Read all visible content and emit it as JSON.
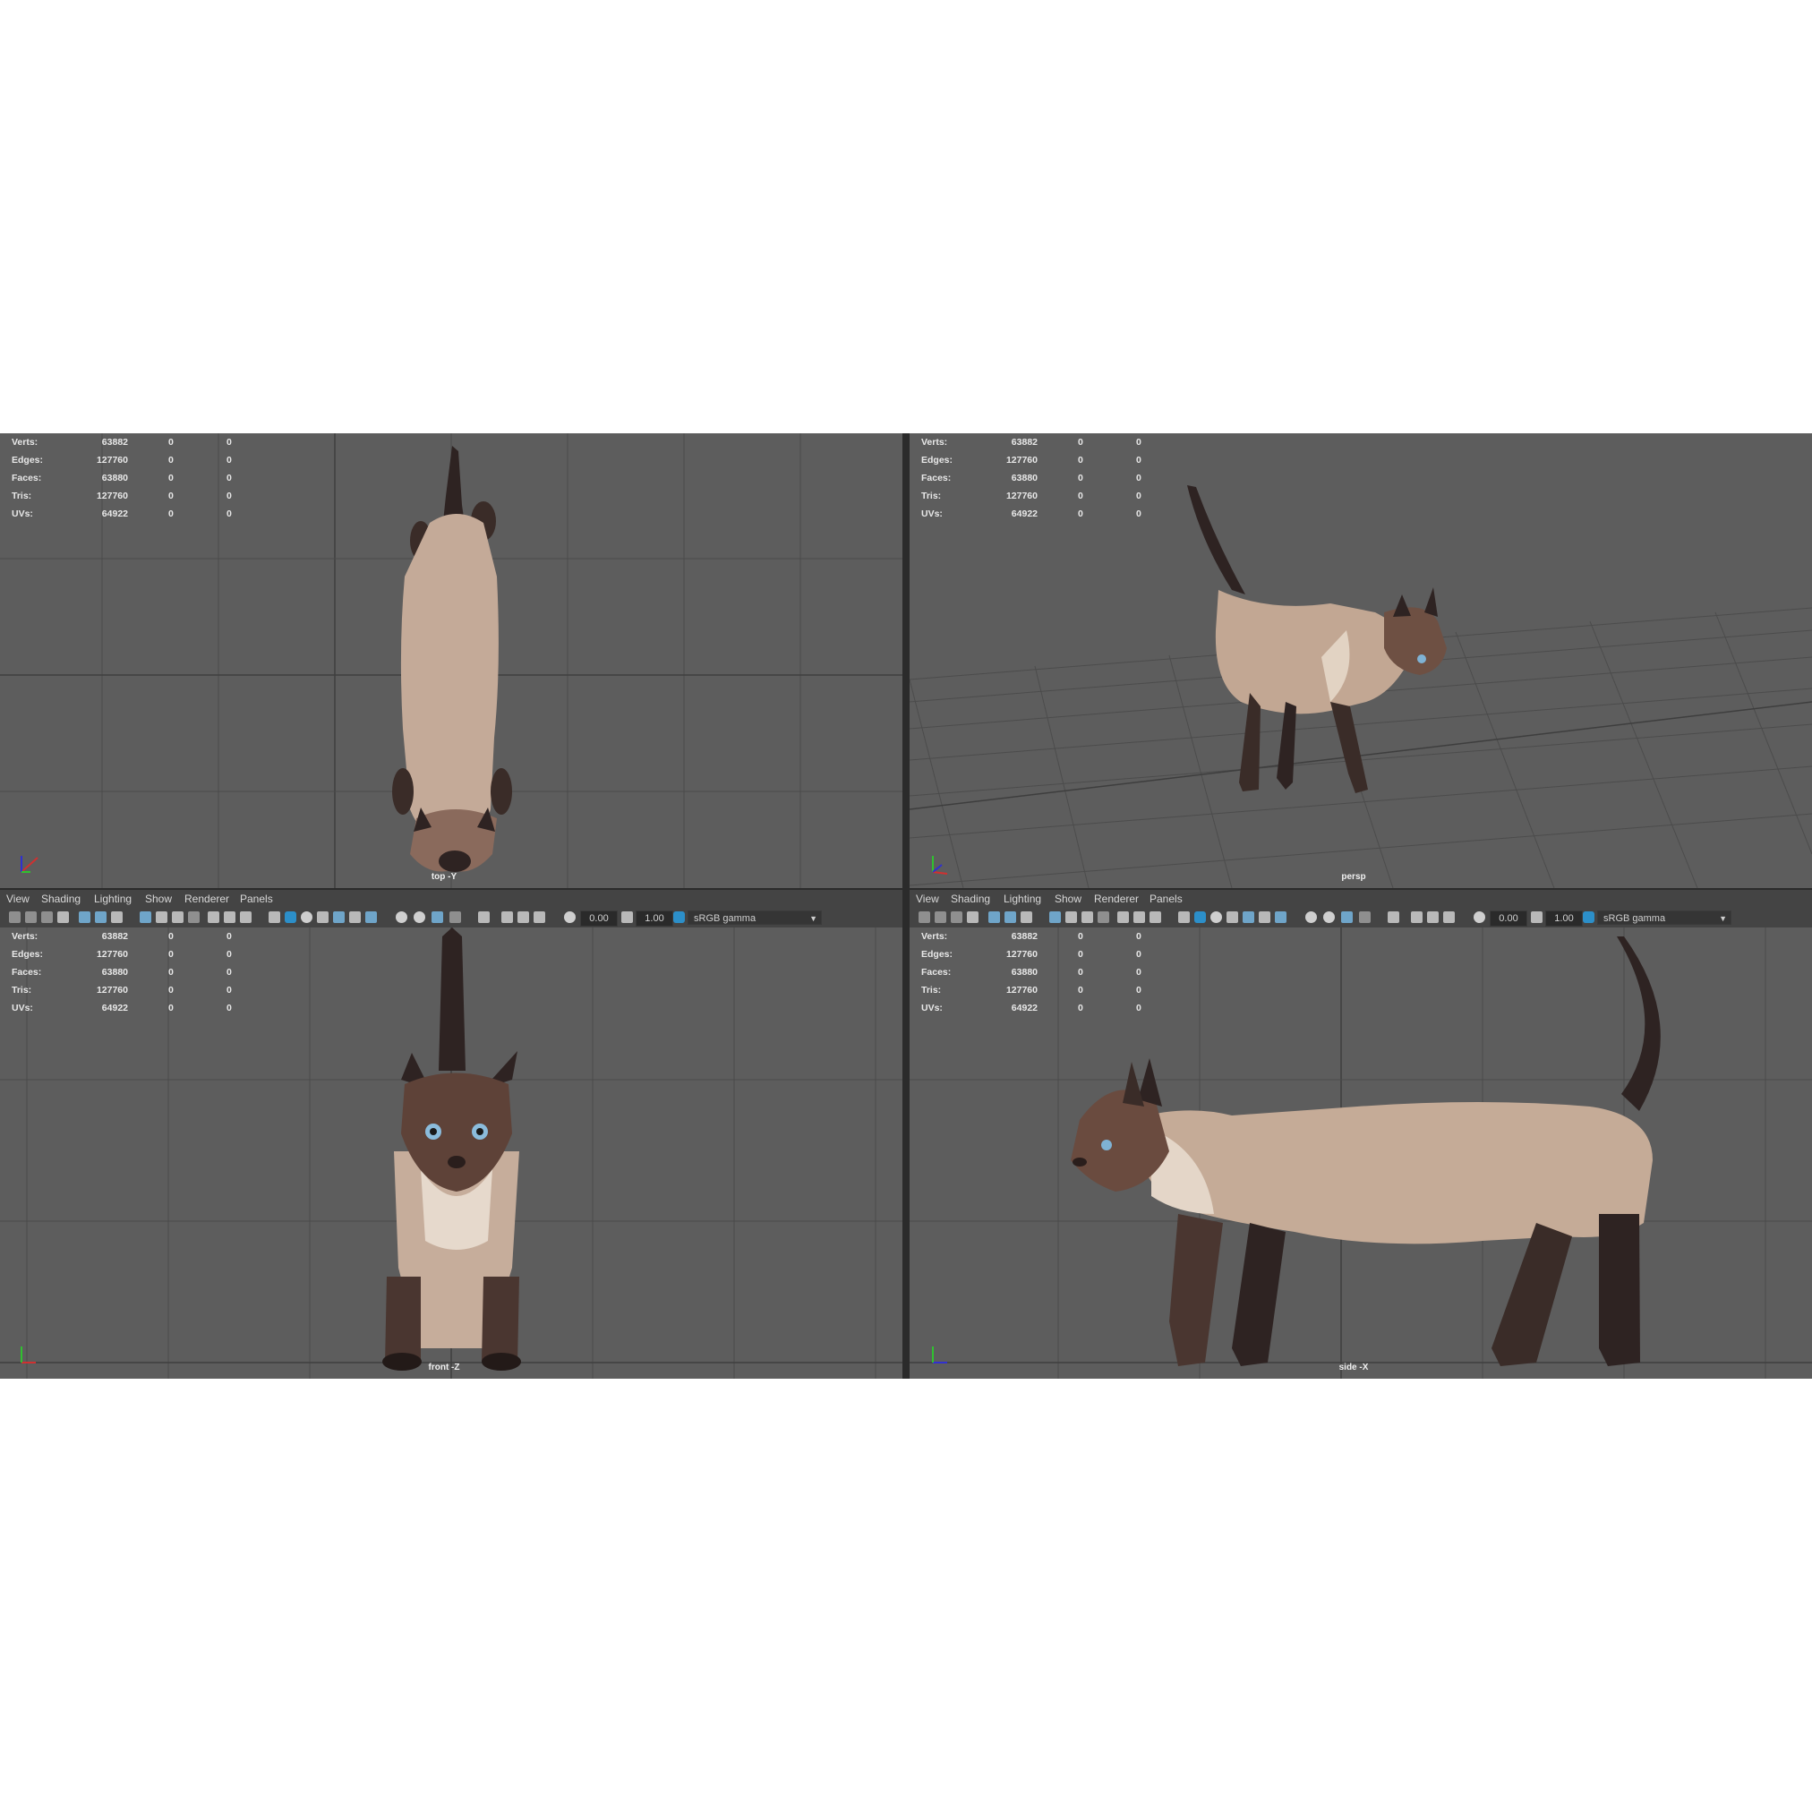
{
  "menu": [
    "View",
    "Shading",
    "Lighting",
    "Show",
    "Renderer",
    "Panels"
  ],
  "hud": [
    {
      "label": "Verts:",
      "v1": "63882",
      "v2": "0",
      "v3": "0"
    },
    {
      "label": "Edges:",
      "v1": "127760",
      "v2": "0",
      "v3": "0"
    },
    {
      "label": "Faces:",
      "v1": "63880",
      "v2": "0",
      "v3": "0"
    },
    {
      "label": "Tris:",
      "v1": "127760",
      "v2": "0",
      "v3": "0"
    },
    {
      "label": "UVs:",
      "v1": "64922",
      "v2": "0",
      "v3": "0"
    }
  ],
  "viewports": {
    "top": {
      "camera": "top -Y"
    },
    "persp": {
      "camera": "persp"
    },
    "front": {
      "camera": "front -Z"
    },
    "side": {
      "camera": "side -X"
    }
  },
  "toolbar": {
    "exposure": "0.00",
    "gamma": "1.00",
    "color_space": "sRGB gamma"
  },
  "colors": {
    "viewport_bg": "#5d5d5d",
    "grid": "#4a4a4a",
    "grid_axis": "#3a3a3a",
    "panel_bar": "#444444",
    "cat_fur": "#c7ad9a",
    "cat_points": "#3a2a25"
  }
}
